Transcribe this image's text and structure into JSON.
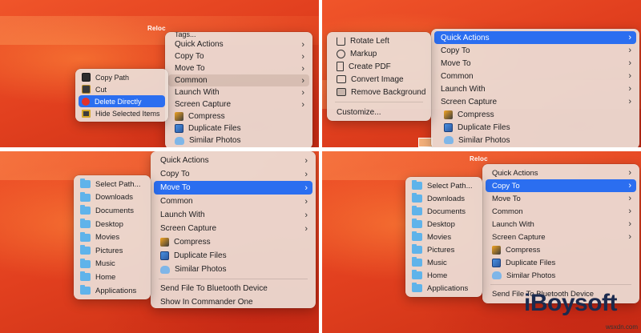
{
  "watermark": {
    "brand": "iBoysoft",
    "site": "wsxdn.com"
  },
  "wallpaper_label": "Reloc",
  "tl": {
    "submenu": {
      "items": [
        {
          "label": "Copy Path",
          "icon": "terminal-icon"
        },
        {
          "label": "Cut",
          "icon": "scissors-icon"
        },
        {
          "label": "Delete Directly",
          "icon": "delete-icon"
        },
        {
          "label": "Hide Selected Items",
          "icon": "hide-icon"
        }
      ],
      "highlighted": "Delete Directly"
    },
    "menu": {
      "partial_top": "Tags...",
      "items": [
        "Quick Actions",
        "Copy To",
        "Move To",
        "Common",
        "Launch With",
        "Screen Capture"
      ],
      "tools": [
        "Compress",
        "Duplicate Files",
        "Similar Photos"
      ],
      "highlighted": "Common"
    }
  },
  "tr": {
    "submenu": {
      "items": [
        {
          "label": "Rotate Left",
          "icon": "rotate-left-icon"
        },
        {
          "label": "Markup",
          "icon": "markup-icon"
        },
        {
          "label": "Create PDF",
          "icon": "pdf-icon"
        },
        {
          "label": "Convert Image",
          "icon": "image-icon"
        },
        {
          "label": "Remove Background",
          "icon": "remove-background-icon"
        }
      ],
      "customize": "Customize..."
    },
    "menu": {
      "items": [
        "Quick Actions",
        "Copy To",
        "Move To",
        "Common",
        "Launch With",
        "Screen Capture"
      ],
      "tools": [
        "Compress",
        "Duplicate Files",
        "Similar Photos"
      ],
      "highlighted": "Quick Actions"
    }
  },
  "bl": {
    "submenu": {
      "items": [
        "Select Path...",
        "Downloads",
        "Documents",
        "Desktop",
        "Movies",
        "Pictures",
        "Music",
        "Home",
        "Applications"
      ]
    },
    "menu": {
      "items": [
        "Quick Actions",
        "Copy To",
        "Move To",
        "Common",
        "Launch With",
        "Screen Capture"
      ],
      "tools": [
        "Compress",
        "Duplicate Files",
        "Similar Photos"
      ],
      "footer": [
        "Send File To Bluetooth Device",
        "Show In Commander One"
      ],
      "highlighted": "Move To"
    }
  },
  "br": {
    "submenu": {
      "items": [
        "Select Path...",
        "Downloads",
        "Documents",
        "Desktop",
        "Movies",
        "Pictures",
        "Music",
        "Home",
        "Applications"
      ]
    },
    "menu": {
      "items": [
        "Quick Actions",
        "Copy To",
        "Move To",
        "Common",
        "Launch With",
        "Screen Capture"
      ],
      "tools": [
        "Compress",
        "Duplicate Files",
        "Similar Photos"
      ],
      "footer": [
        "Send File To Bluetooth Device"
      ],
      "highlighted": "Copy To"
    }
  }
}
